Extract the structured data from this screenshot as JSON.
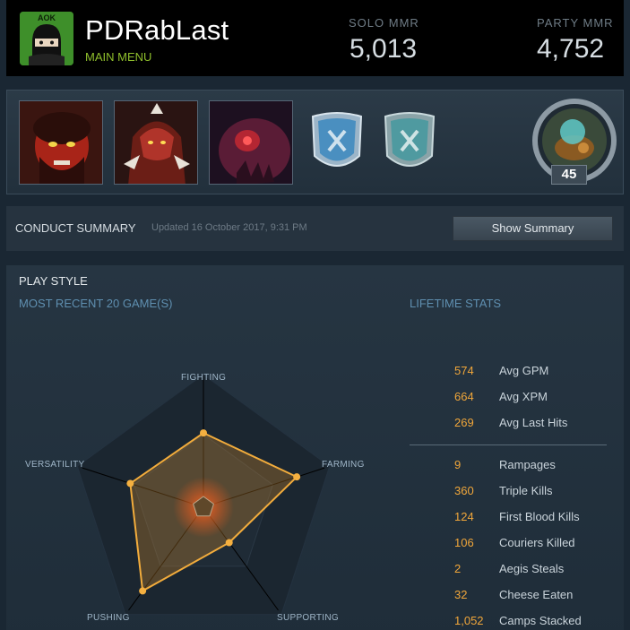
{
  "profile": {
    "avatar_tag": "AOK",
    "username": "PDRabLast",
    "status": "MAIN MENU",
    "solo_mmr_label": "SOLO MMR",
    "solo_mmr_value": "5,013",
    "party_mmr_label": "PARTY MMR",
    "party_mmr_value": "4,752"
  },
  "heroes": [
    {
      "icon": "axe-hero-portrait"
    },
    {
      "icon": "bloodseeker-hero-portrait"
    },
    {
      "icon": "night-stalker-hero-portrait"
    }
  ],
  "badges": [
    {
      "icon": "dota-badge-icon",
      "color": "#4a8fc0"
    },
    {
      "icon": "dota-badge-icon",
      "color": "#4f9aa0"
    }
  ],
  "level": "45",
  "conduct": {
    "title": "CONDUCT SUMMARY",
    "updated": "Updated 16 October 2017, 9:31 PM",
    "button": "Show Summary"
  },
  "play_style": {
    "title": "PLAY STYLE",
    "recent_label": "MOST RECENT 20 GAME(S)",
    "lifetime_label": "LIFETIME STATS",
    "axes": {
      "fighting": "FIGHTING",
      "farming": "FARMING",
      "supporting": "SUPPORTING",
      "pushing": "PUSHING",
      "versatility": "VERSATILITY"
    },
    "radar_values": {
      "fighting": 0.56,
      "farming": 0.74,
      "supporting": 0.33,
      "pushing": 0.78,
      "versatility": 0.58
    }
  },
  "lifetime_stats": [
    {
      "value": "574",
      "label": "Avg GPM"
    },
    {
      "value": "664",
      "label": "Avg XPM"
    },
    {
      "value": "269",
      "label": "Avg Last Hits"
    },
    {
      "value": "9",
      "label": "Rampages"
    },
    {
      "value": "360",
      "label": "Triple Kills"
    },
    {
      "value": "124",
      "label": "First Blood Kills"
    },
    {
      "value": "106",
      "label": "Couriers Killed"
    },
    {
      "value": "2",
      "label": "Aegis Steals"
    },
    {
      "value": "32",
      "label": "Cheese Eaten"
    },
    {
      "value": "1,052",
      "label": "Camps Stacked"
    }
  ],
  "colors": {
    "accent": "#f0a63a",
    "status_green": "#8fbf2c",
    "section_blue": "#5f8fb0"
  }
}
